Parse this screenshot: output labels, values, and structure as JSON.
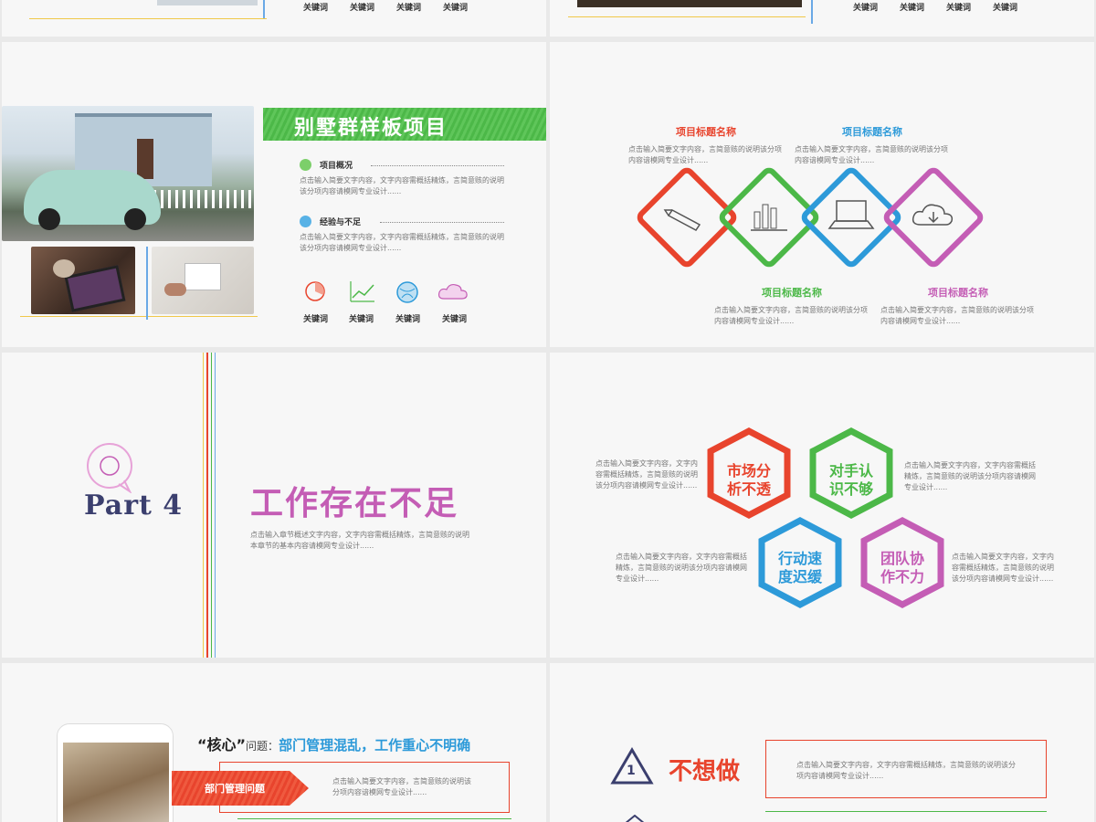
{
  "row0": {
    "left_keywords": [
      "关键词",
      "关键词",
      "关键词",
      "关键词"
    ],
    "right_keywords": [
      "关键词",
      "关键词",
      "关键词",
      "关键词"
    ]
  },
  "villa": {
    "banner": "别墅群样板项目",
    "overview_title": "项目概况",
    "overview_text": "点击输入简要文字内容，文字内容需概括精炼，言简意赅的说明该分项内容请模网专业设计......",
    "lesson_title": "经验与不足",
    "lesson_text": "点击输入简要文字内容，文字内容需概括精炼，言简意赅的说明该分项内容请模网专业设计......",
    "keywords": [
      "关键词",
      "关键词",
      "关键词",
      "关键词"
    ]
  },
  "diamonds": {
    "top_left_title": "项目标题名称",
    "top_left_text": "点击输入简要文字内容，言简意赅的说明该分项内容谙模网专业设计......",
    "top_right_title": "项目标题名称",
    "top_right_text": "点击输入简要文字内容，言简意赅的说明该分项内容谙模网专业设计......",
    "bottom_left_title": "项目标题名称",
    "bottom_left_text": "点击输入简要文字内容，言简意赅的说明该分项内容请模网专业设计......",
    "bottom_right_title": "项目标题名称",
    "bottom_right_text": "点击输入简要文字内容，言简意赅的说明该分项内容请模网专业设计......"
  },
  "part4": {
    "part_label": "Part 4",
    "heading": "工作存在不足",
    "text": "点击输入章节概述文字内容，文字内容需概括精炼，言简意赅的说明本章节的基本内容请模网专业设计......"
  },
  "hexes": {
    "labels": [
      "市场分析不透",
      "对手认识不够",
      "行动速度迟缓",
      "团队协作不力"
    ],
    "text_tl": "点击输入简要文字内容，文字内容需概括精炼，言简意赅的说明该分项内容请模网专业设计......",
    "text_tr": "点击输入简要文字内容，文字内容需概括精炼，言简意赅的说明该分项内容请模网专业设计......",
    "text_bl": "点击输入简要文字内容，文字内容需概括精炼，言简意赅的说明该分项内容请模网专业设计......",
    "text_br": "点击输入简要文字内容，文字内容需概括精炼，言简意赅的说明该分项内容请模网专业设计......"
  },
  "core": {
    "quote": "“核心”",
    "label": "问题：",
    "issue": "部门管理混乱，工作重心不明确",
    "arrow_label": "部门管理问题",
    "text": "点击输入简要文字内容，言简意赅的说明该分项内容谙模网专业设计......"
  },
  "warning": {
    "number": "1",
    "heading": "不想做",
    "text": "点击输入简要文字内容，文字内容需概括精炼，言简意赅的说明该分项内容请模网专业设计......"
  },
  "colors": {
    "red": "#e8442d",
    "green": "#4cb848",
    "blue": "#2d9ad9",
    "pink": "#c45db5"
  }
}
